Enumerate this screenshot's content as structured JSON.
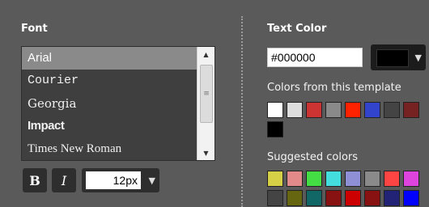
{
  "font_section": {
    "title": "Font",
    "fonts": [
      {
        "label": "Arial",
        "selected": true
      },
      {
        "label": "Courier",
        "selected": false
      },
      {
        "label": "Georgia",
        "selected": false
      },
      {
        "label": "Impact",
        "selected": false
      },
      {
        "label": "Times New Roman",
        "selected": false
      }
    ],
    "bold_label": "B",
    "italic_label": "I",
    "size_value": "12px"
  },
  "color_section": {
    "title": "Text Color",
    "hex_value": "#000000",
    "current_color": "#000000",
    "template_title": "Colors from this template",
    "template_colors": [
      "#ffffff",
      "#dddddd",
      "#cc3333",
      "#8a8a8a",
      "#ff2200",
      "#3344cc",
      "#444444",
      "#772222",
      "#000000"
    ],
    "suggested_title": "Suggested colors",
    "suggested_colors": [
      "#d6d046",
      "#e28a8a",
      "#44dd44",
      "#44dddd",
      "#8f8fd6",
      "#8a8a8a",
      "#ff4444",
      "#dd44dd",
      "#444444",
      "#666611",
      "#116666",
      "#881111",
      "#cc0000",
      "#881111",
      "#222277",
      "#0000ff"
    ]
  }
}
